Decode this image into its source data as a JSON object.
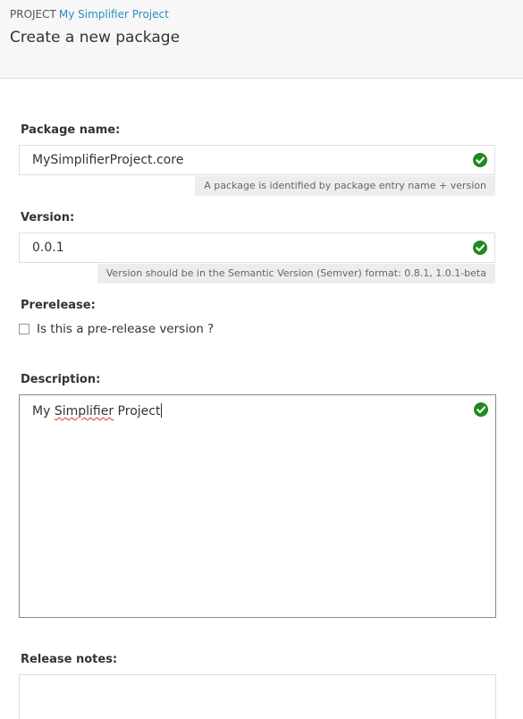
{
  "header": {
    "breadcrumb_prefix": "PROJECT",
    "project_name": "My Simplifier Project",
    "title": "Create a new package"
  },
  "form": {
    "package_name": {
      "label": "Package name:",
      "value": "MySimplifierProject.core",
      "hint": "A package is identified by package entry name + version",
      "status_icon": "check-circle-icon"
    },
    "version": {
      "label": "Version:",
      "value": "0.0.1",
      "hint": "Version should be in the Semantic Version (Semver) format: 0.8.1, 1.0.1-beta",
      "status_icon": "check-circle-icon"
    },
    "prerelease": {
      "label": "Prerelease:",
      "checkbox_label": "Is this a pre-release version ?",
      "checked": false
    },
    "description": {
      "label": "Description:",
      "value_before": "My ",
      "value_misspelled": "Simplifier",
      "value_after": " Project",
      "status_icon": "check-circle-icon"
    },
    "release_notes": {
      "label": "Release notes:",
      "value": ""
    }
  },
  "colors": {
    "valid_green": "#1f8a1f",
    "link_blue": "#2a8fbd",
    "header_bg": "#f7f7f7",
    "hint_bg": "#ededed"
  }
}
